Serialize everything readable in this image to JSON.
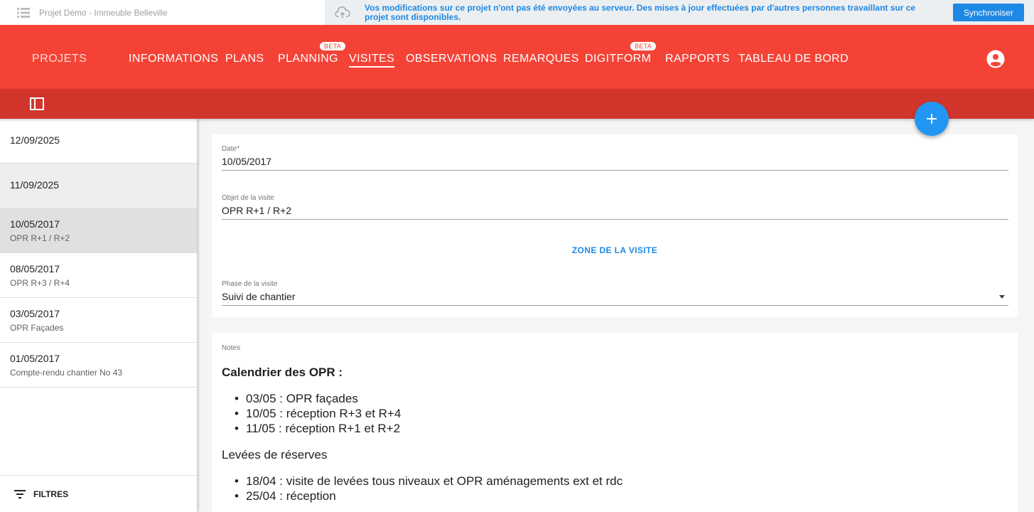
{
  "topbar": {
    "project_name": "Projet Démo - Immeuble Belleville",
    "sync_message": "Vos modifications sur ce projet n'ont pas été envoyées au serveur. Des mises à jour effectuées par d'autres personnes travaillant sur ce projet sont disponibles.",
    "sync_button": "Synchroniser",
    "icons": [
      "list-icon",
      "cloud-upload-icon"
    ]
  },
  "nav": {
    "projets": "PROJETS",
    "tabs": [
      {
        "label": "INFORMATIONS"
      },
      {
        "label": "PLANS"
      },
      {
        "label": "PLANNING",
        "badge": "BETA"
      },
      {
        "label": "VISITES",
        "active": true
      },
      {
        "label": "OBSERVATIONS"
      },
      {
        "label": "REMARQUES"
      },
      {
        "label": "DIGITFORM",
        "badge": "BETA"
      },
      {
        "label": "RAPPORTS"
      },
      {
        "label": "TABLEAU DE BORD"
      }
    ],
    "account_icon": "account-circle-icon"
  },
  "colors": {
    "primary": "#f44336",
    "primary_dark": "#d2352b",
    "accent": "#1e88e5",
    "fab": "#2196f3"
  },
  "sidebar": {
    "visits": [
      {
        "date": "12/09/2025",
        "object": ""
      },
      {
        "date": "11/09/2025",
        "object": ""
      },
      {
        "date": "10/05/2017",
        "object": "OPR R+1 / R+2"
      },
      {
        "date": "08/05/2017",
        "object": "OPR R+3 / R+4"
      },
      {
        "date": "03/05/2017",
        "object": "OPR Façades"
      },
      {
        "date": "01/05/2017",
        "object": "Compte-rendu chantier No 43"
      }
    ],
    "filters_label": "FILTRES"
  },
  "form": {
    "date_label": "Date*",
    "date_value": "10/05/2017",
    "object_label": "Objet de la visite",
    "object_value": "OPR R+1 / R+2",
    "zone_button": "ZONE DE LA VISITE",
    "phase_label": "Phase de la visite",
    "phase_value": "Suivi de chantier"
  },
  "notes": {
    "label": "Notes",
    "heading": "Calendrier des OPR :",
    "list1": [
      "03/05 : OPR façades",
      "10/05 : réception R+3 et R+4",
      "11/05 : réception R+1 et R+2"
    ],
    "paragraph": "Levées de réserves",
    "list2": [
      "18/04 : visite de levées tous niveaux et OPR aménagements ext et rdc",
      "25/04 : réception"
    ]
  }
}
